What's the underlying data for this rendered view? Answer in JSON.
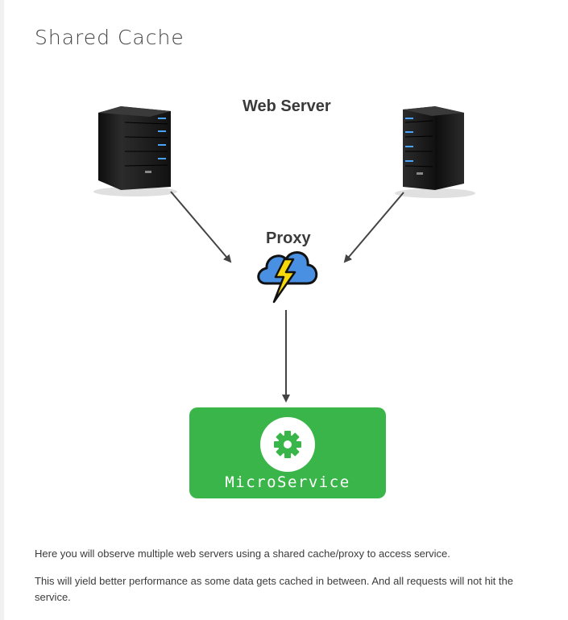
{
  "page": {
    "title": "Shared Cache"
  },
  "diagram": {
    "web_server_label": "Web Server",
    "proxy_label": "Proxy",
    "microservice_label": "MicroService",
    "icons": [
      "server-icon",
      "server-icon",
      "cloud-lightning-icon",
      "gear-icon"
    ],
    "colors": {
      "microservice_box": "#3ab54a",
      "server_body": "#1c1c1c",
      "server_led": "#4aa3ff",
      "cloud_fill": "#4a90e2",
      "lightning": "#f5d90a",
      "arrow": "#444444"
    }
  },
  "body": {
    "paragraph_1": "Here you will observe multiple web servers using a shared cache/proxy to access service.",
    "paragraph_2": "This will yield better performance as some data gets cached in between. And all requests will not hit the service."
  }
}
